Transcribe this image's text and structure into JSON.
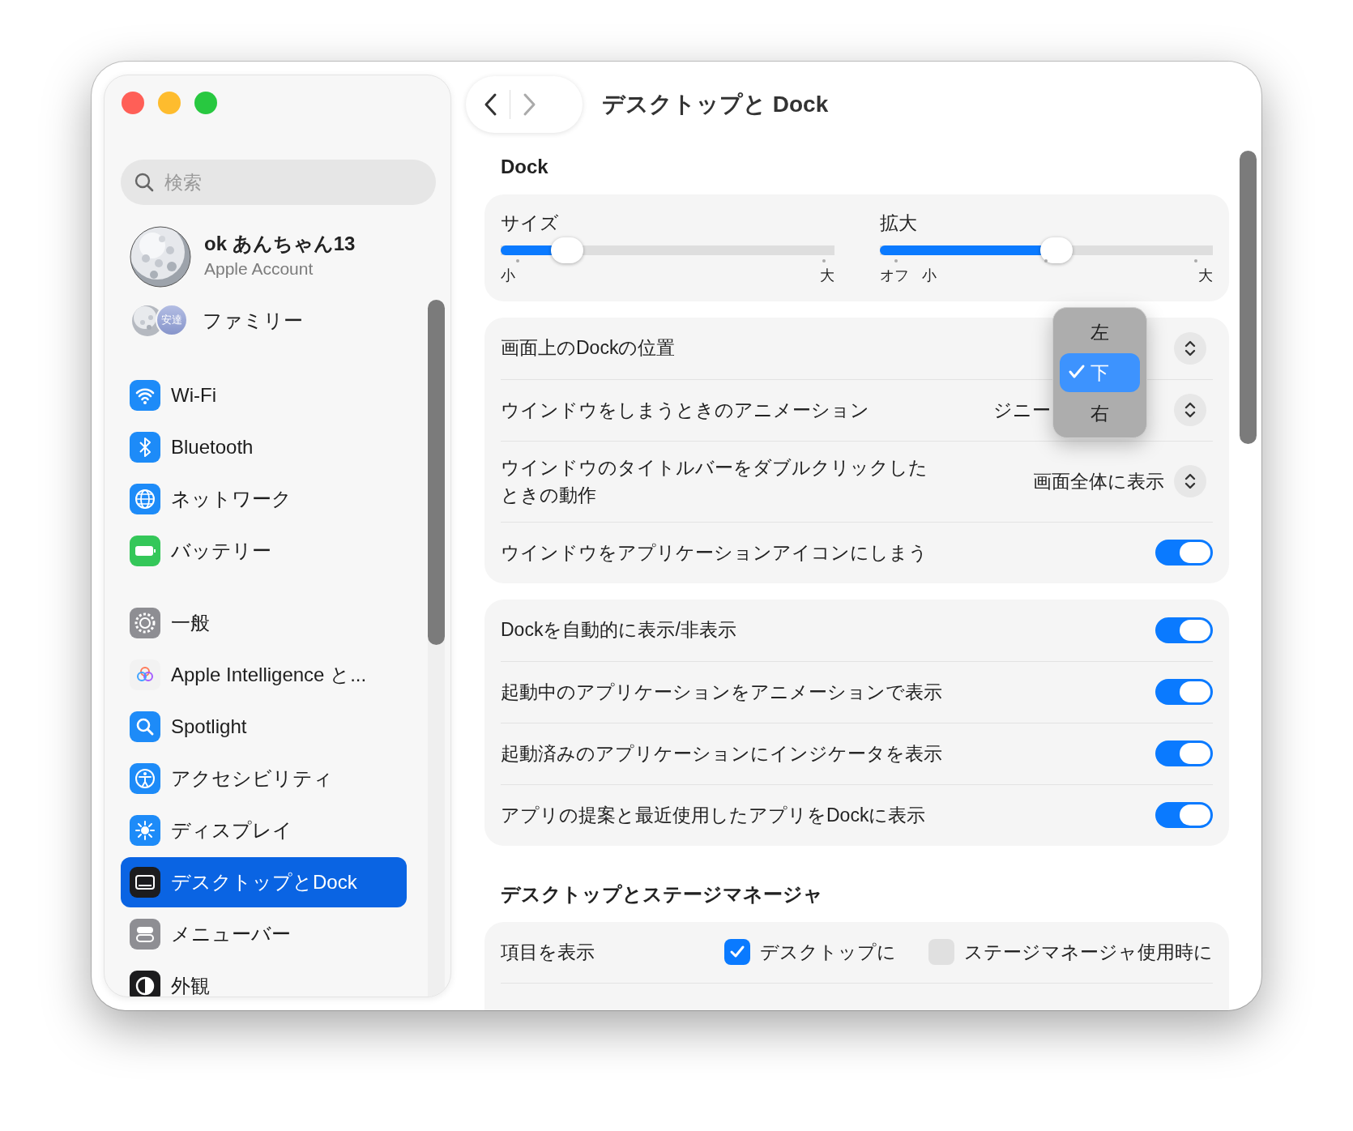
{
  "sidebar": {
    "search": {
      "placeholder": "検索"
    },
    "account": {
      "name": "ok あんちゃん13",
      "subtitle": "Apple Account"
    },
    "family": {
      "label": "ファミリー",
      "badge": "安達"
    },
    "groups": [
      [
        {
          "label": "Wi-Fi",
          "selected": false
        },
        {
          "label": "Bluetooth",
          "selected": false
        },
        {
          "label": "ネットワーク",
          "selected": false
        },
        {
          "label": "バッテリー",
          "selected": false
        }
      ],
      [
        {
          "label": "一般",
          "selected": false
        },
        {
          "label": "Apple Intelligence と...",
          "selected": false
        },
        {
          "label": "Spotlight",
          "selected": false
        },
        {
          "label": "アクセシビリティ",
          "selected": false
        },
        {
          "label": "ディスプレイ",
          "selected": false
        },
        {
          "label": "デスクトップとDock",
          "selected": true
        },
        {
          "label": "メニューバー",
          "selected": false
        },
        {
          "label": "外観",
          "selected": false
        }
      ]
    ]
  },
  "title": "デスクトップと Dock",
  "dock": {
    "heading": "Dock",
    "sliders": [
      {
        "label": "サイズ",
        "level": 0.2,
        "ticks": [
          "小",
          "大"
        ]
      },
      {
        "label": "拡大",
        "level": 0.53,
        "ticks": [
          "オフ",
          "小",
          "大"
        ]
      }
    ]
  },
  "window_settings": [
    {
      "kind": "popup",
      "label": "画面上のDockの位置"
    },
    {
      "kind": "popup",
      "label": "ウインドウをしまうときのアニメーション",
      "value": "ジニー"
    },
    {
      "kind": "popup",
      "label": "ウインドウのタイトルバーをダブルクリックしたときの動作",
      "value": "画面全体に表示"
    },
    {
      "kind": "toggle",
      "label": "ウインドウをアプリケーションアイコンにしまう",
      "on": true
    }
  ],
  "position_menu": {
    "options": [
      {
        "label": "左",
        "selected": false
      },
      {
        "label": "下",
        "selected": true
      },
      {
        "label": "右",
        "selected": false
      }
    ]
  },
  "behavior": [
    {
      "kind": "toggle",
      "label": "Dockを自動的に表示/非表示",
      "on": true
    },
    {
      "kind": "toggle",
      "label": "起動中のアプリケーションをアニメーションで表示",
      "on": true
    },
    {
      "kind": "toggle",
      "label": "起動済みのアプリケーションにインジケータを表示",
      "on": true
    },
    {
      "kind": "toggle",
      "label": "アプリの提案と最近使用したアプリをDockに表示",
      "on": true
    }
  ],
  "stage_manager": {
    "heading": "デスクトップとステージマネージャ",
    "rows": [
      {
        "label": "項目を表示",
        "options": [
          {
            "label": "デスクトップに",
            "checked": true
          },
          {
            "label": "ステージマネージャ使用時に",
            "checked": false
          }
        ]
      }
    ]
  }
}
